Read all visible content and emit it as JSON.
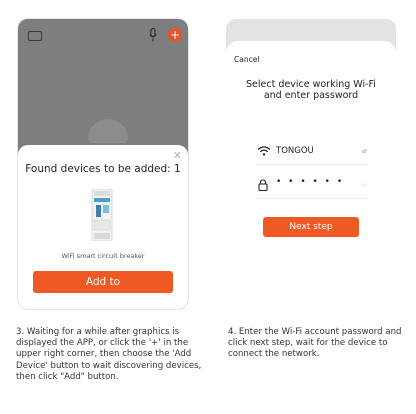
{
  "left_screen": {
    "sheet_title": "Found devices to be added: 1",
    "device_name": "WiFi smart circuit breaker",
    "add_button": "Add to",
    "icons": [
      "list-icon",
      "mic-icon",
      "plus-icon",
      "close-icon"
    ]
  },
  "right_screen": {
    "cancel": "Cancel",
    "title_line1": "Select device working Wi-Fi",
    "title_line2": "and enter password",
    "wifi_name": "TONGOU",
    "password_mask": "• • • • • •",
    "next_button": "Next step",
    "icons": [
      "wifi-icon",
      "swap-icon",
      "lock-icon",
      "eye-icon"
    ]
  },
  "captions": {
    "step3": "3. Waiting for a while after graphics is displayed the APP, or click the '+' in the upper right corner, then choose the 'Add Device' button to wait discovering devices, then click \"Add\" button.",
    "step4": "4. Enter the Wi-Fi account password and click next step, wait for the device to connect the network."
  },
  "colors": {
    "accent": "#ef5a24",
    "overlay": "#7e7e7e",
    "panel_bg": "#e3e3e3"
  }
}
